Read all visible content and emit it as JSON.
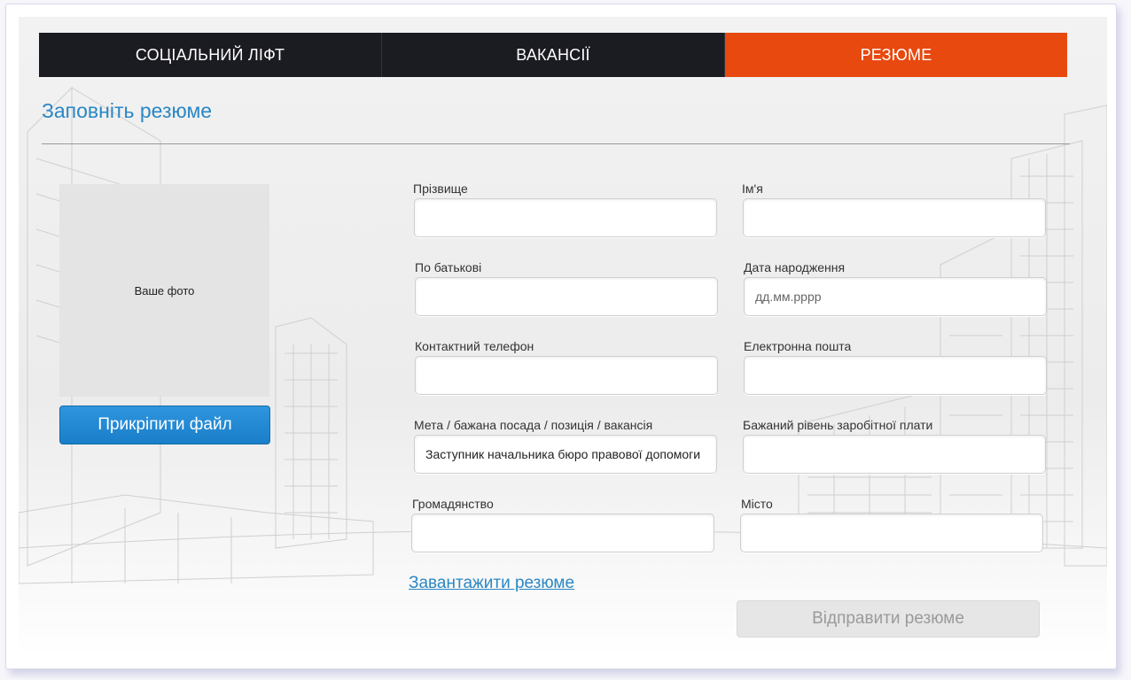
{
  "nav": {
    "tabs": [
      {
        "label": "СОЦІАЛЬНИЙ ЛІФТ"
      },
      {
        "label": "ВАКАНСІЇ"
      },
      {
        "label": "РЕЗЮМЕ"
      }
    ],
    "active_index": 2
  },
  "page": {
    "title": "Заповніть резюме"
  },
  "photo": {
    "placeholder": "Ваше фото",
    "attach_label": "Прикріпити файл"
  },
  "form": {
    "surname": {
      "label": "Прізвище",
      "value": ""
    },
    "name": {
      "label": "Ім'я",
      "value": ""
    },
    "patronymic": {
      "label": "По батькові",
      "value": ""
    },
    "birth_date": {
      "label": "Дата народження",
      "value": "",
      "placeholder": "дд.мм.рррр"
    },
    "phone": {
      "label": "Контактний телефон",
      "value": ""
    },
    "email": {
      "label": "Електронна пошта",
      "value": ""
    },
    "position": {
      "label": "Мета / бажана посада / позиція / вакансія",
      "value": "Заступник начальника бюро правової допомоги"
    },
    "salary": {
      "label": "Бажаний рівень заробітної плати",
      "value": ""
    },
    "citizenship": {
      "label": "Громадянство",
      "value": ""
    },
    "city": {
      "label": "Місто",
      "value": ""
    }
  },
  "actions": {
    "download_label": "Завантажити резюме",
    "submit_label": "Відправити резюме"
  },
  "colors": {
    "accent": "#e8490f",
    "nav_bg": "#1b1b22",
    "link": "#2a87c4",
    "button": "#1a7ec9"
  }
}
